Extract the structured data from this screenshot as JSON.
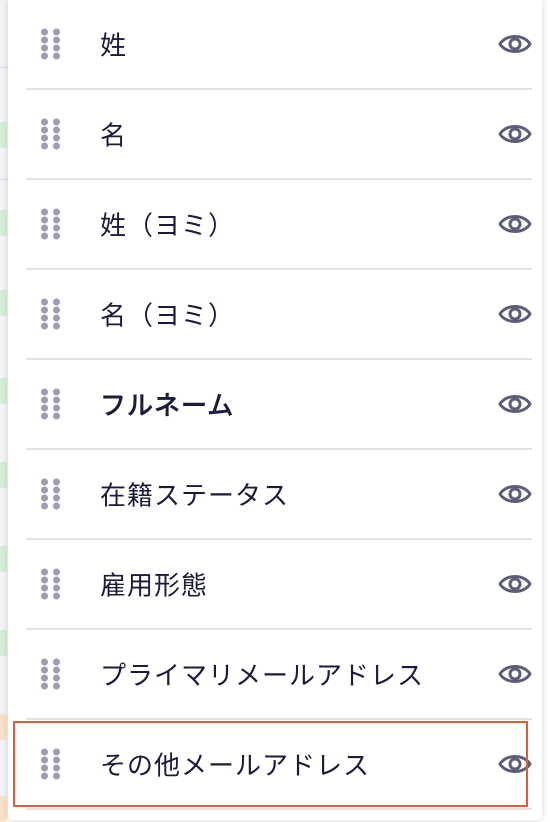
{
  "colors": {
    "text": "#1b1c3a",
    "grip": "#9b9db2",
    "eye": "#5c5e78",
    "divider": "#e3e3e8",
    "highlight": "#e15a3c"
  },
  "columns": {
    "items": [
      {
        "label": "姓",
        "bold": false,
        "icon": "eye-icon",
        "visible": true
      },
      {
        "label": "名",
        "bold": false,
        "icon": "eye-icon",
        "visible": true
      },
      {
        "label": "姓（ヨミ）",
        "bold": false,
        "icon": "eye-icon",
        "visible": true
      },
      {
        "label": "名（ヨミ）",
        "bold": false,
        "icon": "eye-icon",
        "visible": true
      },
      {
        "label": "フルネーム",
        "bold": true,
        "icon": "eye-icon",
        "visible": true
      },
      {
        "label": "在籍ステータス",
        "bold": false,
        "icon": "eye-icon",
        "visible": true
      },
      {
        "label": "雇用形態",
        "bold": false,
        "icon": "eye-icon",
        "visible": true
      },
      {
        "label": "プライマリメールアドレス",
        "bold": false,
        "icon": "eye-icon",
        "visible": true
      },
      {
        "label": "その他メールアドレス",
        "bold": false,
        "icon": "eye-icon",
        "visible": true,
        "highlighted": true
      }
    ]
  }
}
